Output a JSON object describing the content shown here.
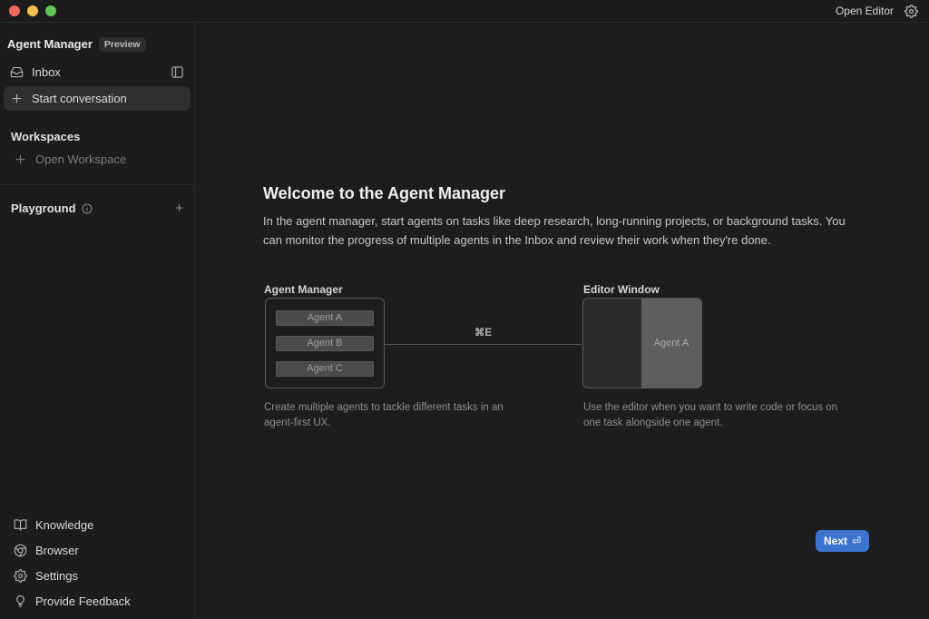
{
  "titlebar": {
    "open_editor_label": "Open Editor"
  },
  "sidebar": {
    "title": "Agent Manager",
    "badge": "Preview",
    "inbox_label": "Inbox",
    "start_conversation_label": "Start conversation",
    "workspaces_header": "Workspaces",
    "open_workspace_label": "Open Workspace",
    "playground_label": "Playground",
    "bottom": [
      {
        "label": "Knowledge",
        "icon": "book-open-icon"
      },
      {
        "label": "Browser",
        "icon": "browser-icon"
      },
      {
        "label": "Settings",
        "icon": "gear-icon"
      },
      {
        "label": "Provide Feedback",
        "icon": "lightbulb-icon"
      }
    ]
  },
  "main": {
    "heading": "Welcome to the Agent Manager",
    "description": "In the agent manager, start agents on tasks like deep research, long-running projects, or background tasks. You can monitor the progress of multiple agents in the Inbox and review their work when they're done.",
    "diagram": {
      "left": {
        "label": "Agent Manager",
        "agents": [
          "Agent A",
          "Agent B",
          "Agent C"
        ],
        "caption": "Create multiple agents to tackle different tasks in an agent-first UX."
      },
      "shortcut": "⌘E",
      "right": {
        "label": "Editor Window",
        "agent": "Agent A",
        "caption": "Use the editor when you want to write code or focus on one task alongside one agent."
      }
    },
    "next_label": "Next",
    "next_icon": "⏎"
  },
  "colors": {
    "background": "#1c1c1c",
    "divider": "#2b2b2b",
    "selected_row": "#2f2f2f",
    "accent_blue": "#3b73cd",
    "traffic_red": "#ee6a5f",
    "traffic_yellow": "#f5bf4f",
    "traffic_green": "#61c554",
    "editor_pane_gray": "#5e5e5e",
    "agent_chip_gray": "#4b4b4b"
  }
}
